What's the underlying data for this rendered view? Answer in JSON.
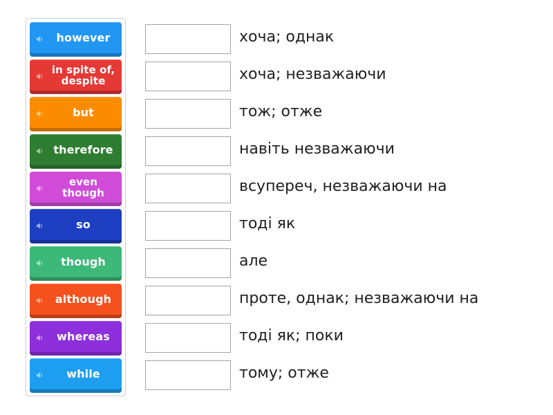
{
  "tiles": [
    {
      "label": "however",
      "color": "#2196f3"
    },
    {
      "label": "in spite of,\ndespite",
      "color": "#e53935"
    },
    {
      "label": "but",
      "color": "#fb8c00"
    },
    {
      "label": "therefore",
      "color": "#2e7d32"
    },
    {
      "label": "even\nthough",
      "color": "#d04bd8"
    },
    {
      "label": "so",
      "color": "#1e3fc2"
    },
    {
      "label": "though",
      "color": "#3cb878"
    },
    {
      "label": "although",
      "color": "#f4511e"
    },
    {
      "label": "whereas",
      "color": "#8e2fdc"
    },
    {
      "label": "while",
      "color": "#1e9ef0"
    }
  ],
  "definitions": [
    "хоча; однак",
    "хоча; незважаючи",
    "тож; отже",
    "навіть незважаючи",
    "всупереч, незважаючи на",
    "тоді як",
    "але",
    "проте, однак; незважаючи на",
    "тоді як; поки",
    "тому; отже"
  ],
  "icons": {
    "tile_icon": "speaker-icon"
  }
}
